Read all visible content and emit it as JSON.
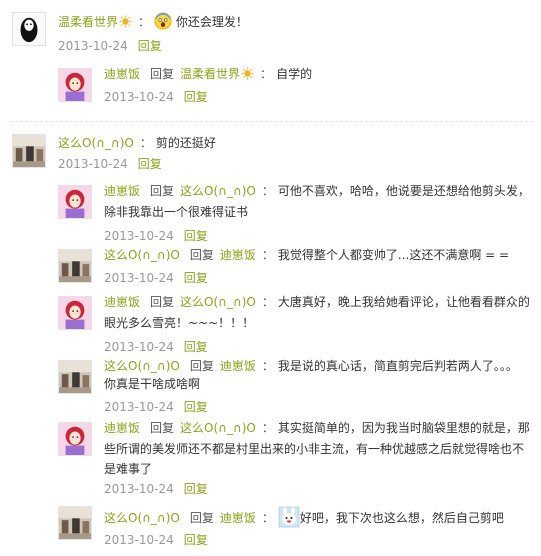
{
  "reply_word": "回复",
  "colon": "：",
  "threads": [
    {
      "user": "温柔看世界",
      "text": "你还会理发！",
      "date": "2013-10-24",
      "reply_label": "回复",
      "replies": [
        {
          "user": "迪崽饭",
          "to": "温柔看世界",
          "text": "自学的",
          "date": "2013-10-24",
          "reply_label": "回复"
        }
      ]
    },
    {
      "user": "这么O(∩_∩)O",
      "text": "剪的还挺好",
      "date": "2013-10-24",
      "reply_label": "回复",
      "replies": [
        {
          "user": "迪崽饭",
          "to": "这么O(∩_∩)O",
          "text_line1": "可他不喜欢，哈哈，他说要是还想给他剪头发，",
          "text_line2": "除非我靠出一个很难得证书",
          "date": "2013-10-24",
          "reply_label": "回复"
        },
        {
          "user": "这么O(∩_∩)O",
          "to": "迪崽饭",
          "text": "我觉得整个人都变帅了...这还不满意啊 = =",
          "date": "2013-10-24",
          "reply_label": "回复"
        },
        {
          "user": "迪崽饭",
          "to": "这么O(∩_∩)O",
          "text_line1": "大唐真好，晚上我给她看评论，让他看看群众的",
          "text_line2": "眼光多么雪亮！~~~！！！",
          "date": "2013-10-24",
          "reply_label": "回复"
        },
        {
          "user": "这么O(∩_∩)O",
          "to": "迪崽饭",
          "text_line1": "我是说的真心话，简直剪完后判若两人了。。。",
          "text_line2": "你真是干啥成啥啊",
          "date": "2013-10-24",
          "reply_label": "回复"
        },
        {
          "user": "迪崽饭",
          "to": "这么O(∩_∩)O",
          "text_line1": "其实挺简单的，因为我当时脑袋里想的就是，那",
          "text_line2": "些所谓的美发师还不都是村里出来的小非主流，有一种优越感之后就觉得啥也不",
          "text_line3": "是难事了",
          "date": "2013-10-24",
          "reply_label": "回复"
        },
        {
          "user": "这么O(∩_∩)O",
          "to": "迪崽饭",
          "text": "好吧，我下次也这么想，然后自己剪吧",
          "date": "2013-10-24",
          "reply_label": "回复"
        }
      ]
    }
  ]
}
